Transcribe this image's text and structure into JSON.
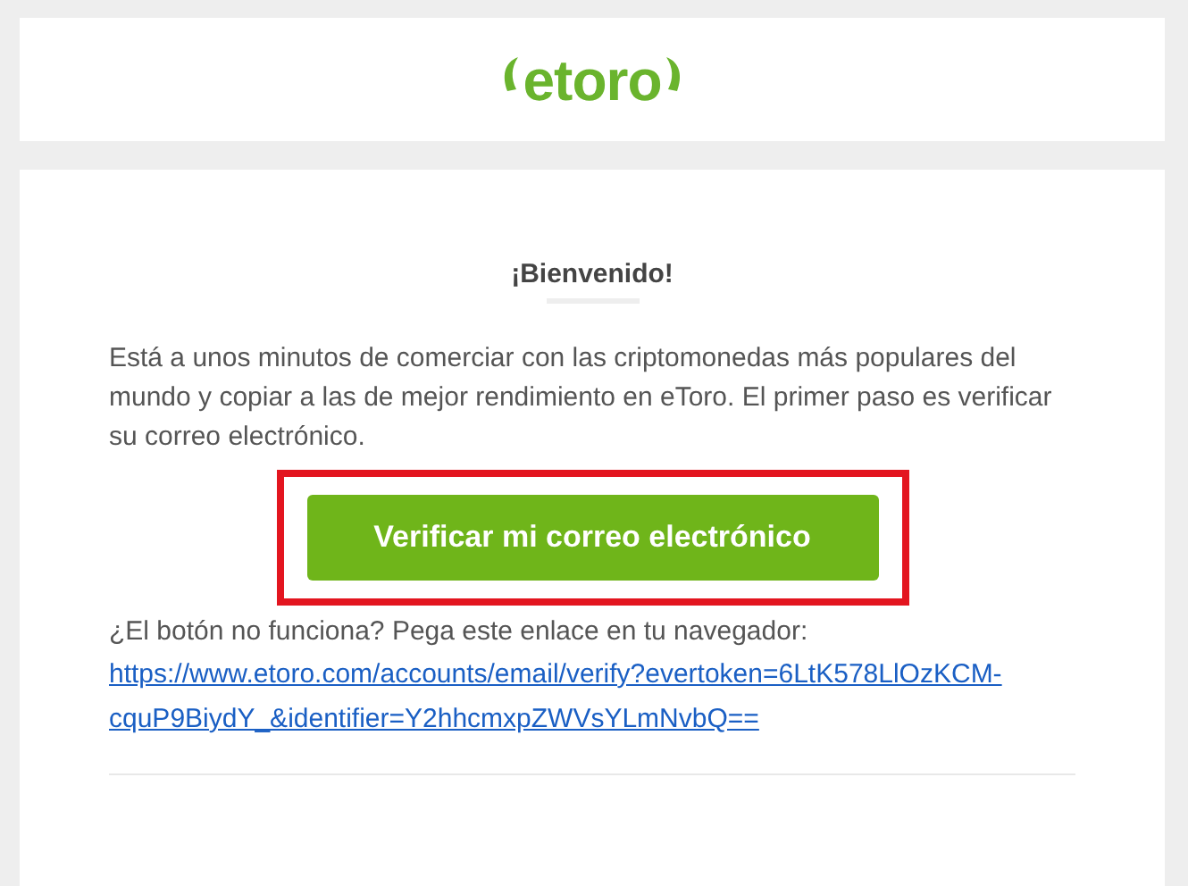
{
  "header": {
    "logo": "etoro"
  },
  "email": {
    "heading": "¡Bienvenido!",
    "body": "Está a unos minutos de comerciar con las criptomonedas más populares del mundo y copiar a las de mejor rendimiento en eToro. El primer paso es verificar su correo electrónico.",
    "button": {
      "label": "Verificar mi correo electrónico",
      "highlighted": true
    },
    "fallback_text": "¿El botón no funciona? Pega este enlace en tu navegador:",
    "link": "https://www.etoro.com/accounts/email/verify?evertoken=6LtK578LlOzKCM-cquP9BiydY_&identifier=Y2hhcmxpZWVsYLmNvbQ=="
  }
}
